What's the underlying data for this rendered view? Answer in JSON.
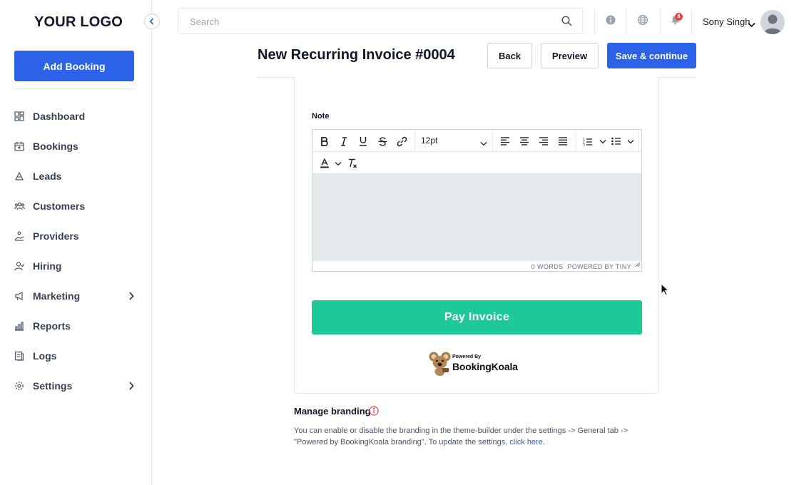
{
  "sidebar": {
    "logo": "YOUR LOGO",
    "add_booking": "Add Booking",
    "items": [
      {
        "label": "Dashboard",
        "icon": "dashboard-icon"
      },
      {
        "label": "Bookings",
        "icon": "calendar-icon"
      },
      {
        "label": "Leads",
        "icon": "leads-icon"
      },
      {
        "label": "Customers",
        "icon": "customers-icon"
      },
      {
        "label": "Providers",
        "icon": "providers-icon"
      },
      {
        "label": "Hiring",
        "icon": "hiring-icon"
      },
      {
        "label": "Marketing",
        "icon": "marketing-icon",
        "has_submenu": true
      },
      {
        "label": "Reports",
        "icon": "reports-icon"
      },
      {
        "label": "Logs",
        "icon": "logs-icon"
      },
      {
        "label": "Settings",
        "icon": "settings-icon",
        "has_submenu": true
      }
    ]
  },
  "topbar": {
    "search_placeholder": "Search",
    "notification_count": "6",
    "user_name": "Sony Singh"
  },
  "header": {
    "title": "New Recurring Invoice #0004",
    "back": "Back",
    "preview": "Preview",
    "save": "Save & continue"
  },
  "invoice": {
    "note_label": "Note",
    "font_size": "12pt",
    "word_count": "0 WORDS",
    "powered_by_tiny": "POWERED BY TINY",
    "pay_button": "Pay Invoice",
    "powered_small": "Powered By",
    "powered_brand": "BookingKoala"
  },
  "branding": {
    "title": "Manage branding",
    "text": "You can enable or disable the branding in the theme-builder under the settings -> General tab -> \"Powered by BookingKoala branding\". To update the settings, ",
    "link": "click here",
    "suffix": "."
  },
  "colors": {
    "primary": "#2b62e8",
    "pay": "#1dc997",
    "badge": "#ef4444",
    "editor_bg": "#e5eaed"
  }
}
